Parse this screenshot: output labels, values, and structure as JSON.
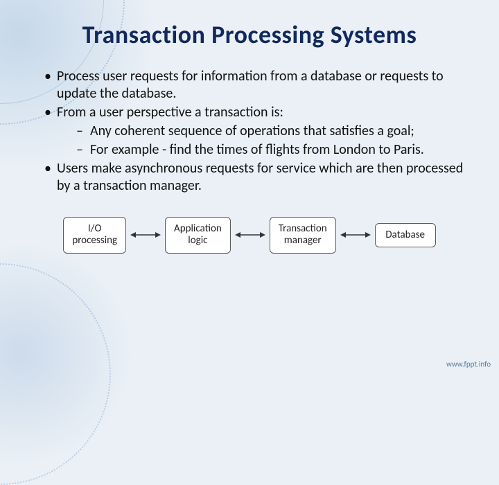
{
  "title": "Transaction Processing Systems",
  "bullets": {
    "b1": "Process user requests for information from a database or requests to update the database.",
    "b2": "From a user perspective a transaction is:",
    "b2_sub1": "Any coherent sequence of operations that satisfies a goal;",
    "b2_sub2": "For example - find the times of flights from London to Paris.",
    "b3": "Users make asynchronous requests for service which are then processed by a transaction manager."
  },
  "diagram": {
    "box1_line1": "I/O",
    "box1_line2": "processing",
    "box2_line1": "Application",
    "box2_line2": "logic",
    "box3_line1": "Transaction",
    "box3_line2": "manager",
    "box4": "Database"
  },
  "footer": "www.fppt.info"
}
